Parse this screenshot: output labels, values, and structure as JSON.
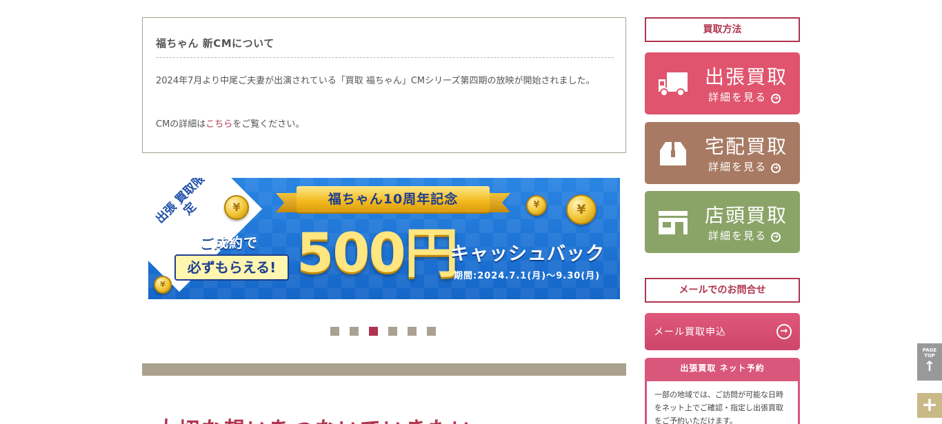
{
  "notice": {
    "title": "福ちゃん 新CMについて",
    "body": "2024年7月より中尾ご夫妻が出演されている「買取 福ちゃん」CMシリーズ第四期の放映が開始されました。",
    "detail_prefix": "CMの詳細は",
    "detail_link": "こちら",
    "detail_suffix": "をご覧ください。"
  },
  "banner": {
    "corner": "出張 買取限定",
    "ribbon": "福ちゃん10周年記念",
    "sub": "ご成約で",
    "pill": "必ずもらえる!",
    "amount": "500円",
    "cash": "キャッシュバック",
    "period": "期間:2024.7.1(月)〜9.30(月)"
  },
  "slider": {
    "count": 6,
    "active_index": 2
  },
  "main_heading": "大切な想いをつないでいきたい",
  "sidebar": {
    "methods_title": "買取方法",
    "cards": [
      {
        "title": "出張買取",
        "more": "詳細を見る",
        "icon": "truck-icon",
        "color": "#e0546e"
      },
      {
        "title": "宅配買取",
        "more": "詳細を見る",
        "icon": "box-icon",
        "color": "#a87a63"
      },
      {
        "title": "店頭買取",
        "more": "詳細を見る",
        "icon": "store-icon",
        "color": "#8aa468"
      }
    ],
    "mail_title": "メールでのお問合せ",
    "mail_button": "メール買取申込",
    "reserve_title": "出張買取 ネット予約",
    "reserve_body": "一部の地域では、ご訪問が可能な日時をネット上でご確認・指定し出張買取をご予約いただけます。"
  },
  "floating": {
    "page_top": "PAGE TOP",
    "plus": "+"
  },
  "colors": {
    "accent": "#b0334f",
    "dot": "#aba191"
  }
}
